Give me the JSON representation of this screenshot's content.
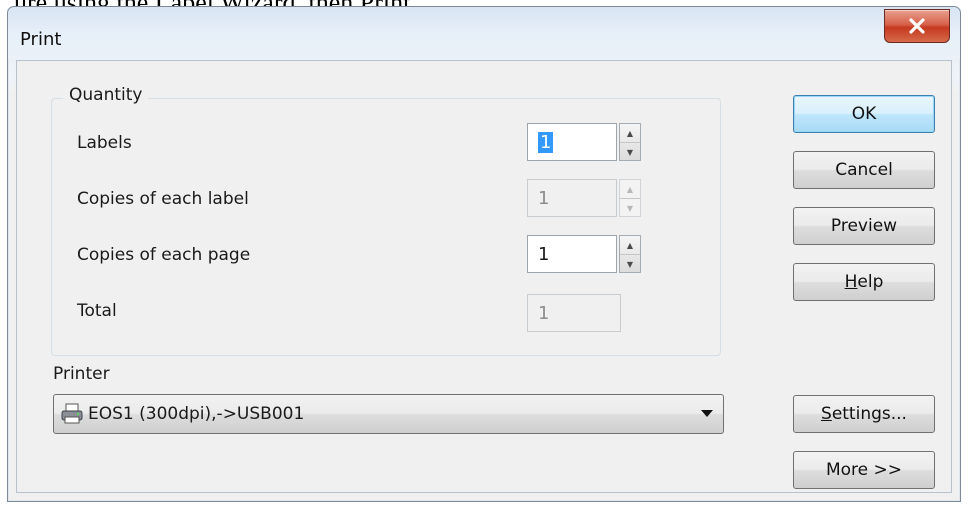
{
  "background_text": "ure using the Label Wizard,  then Print.",
  "window": {
    "title": "Print",
    "close_icon": "close-x-icon"
  },
  "quantity": {
    "legend": "Quantity",
    "rows": [
      {
        "label": "Labels",
        "value": "1",
        "enabled": true,
        "selected": true
      },
      {
        "label": "Copies of each label",
        "value": "1",
        "enabled": false,
        "selected": false
      },
      {
        "label": "Copies of each page",
        "value": "1",
        "enabled": true,
        "selected": false
      }
    ],
    "total_label": "Total",
    "total_value": "1"
  },
  "printer": {
    "label": "Printer",
    "selected": "EOS1 (300dpi),->USB001",
    "icon": "printer-icon"
  },
  "buttons": {
    "ok": "OK",
    "cancel": "Cancel",
    "preview": "Preview",
    "help_mnemonic": "H",
    "help_rest": "elp",
    "settings_mnemonic": "S",
    "settings_rest": "ettings...",
    "more": "More >>"
  },
  "colors": {
    "default_button": "#bee6fd",
    "close_button": "#c5391f",
    "selection": "#3399ff"
  }
}
